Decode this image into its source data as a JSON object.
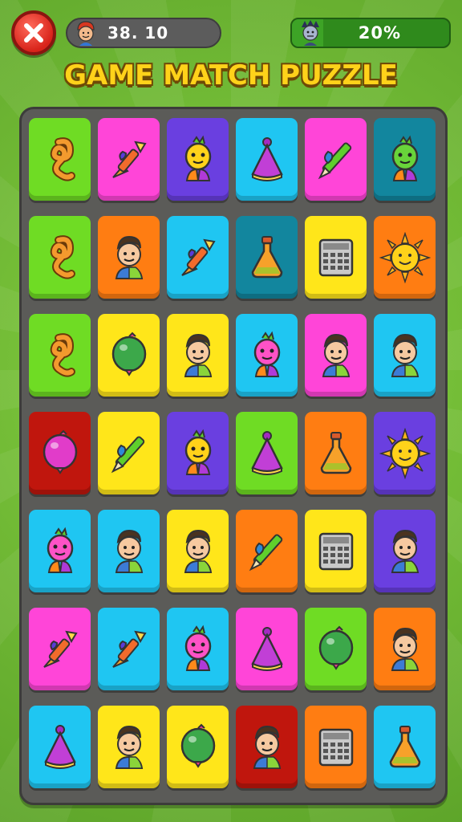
{
  "hud": {
    "score": "38. 10",
    "progress_text": "20%",
    "progress_value": 0.2
  },
  "title": "GAME MATCH PUZZLE",
  "colors": {
    "lime": "#6fdc24",
    "pink": "#ff45d8",
    "purple": "#6a3fe0",
    "cyan": "#1fc6f2",
    "teal": "#12869e",
    "orange": "#ff7d12",
    "yellow": "#ffe61a",
    "red": "#c0160d"
  },
  "board": {
    "rows": [
      [
        {
          "color": "lime",
          "icon": "swirl"
        },
        {
          "color": "pink",
          "icon": "brush"
        },
        {
          "color": "purple",
          "icon": "creature"
        },
        {
          "color": "cyan",
          "icon": "party-hat"
        },
        {
          "color": "pink",
          "icon": "pen"
        },
        {
          "color": "teal",
          "icon": "creature"
        }
      ],
      [
        {
          "color": "lime",
          "icon": "swirl"
        },
        {
          "color": "orange",
          "icon": "person"
        },
        {
          "color": "cyan",
          "icon": "brush"
        },
        {
          "color": "teal",
          "icon": "flask"
        },
        {
          "color": "yellow",
          "icon": "calculator"
        },
        {
          "color": "orange",
          "icon": "sun"
        }
      ],
      [
        {
          "color": "lime",
          "icon": "swirl"
        },
        {
          "color": "yellow",
          "icon": "balloon"
        },
        {
          "color": "yellow",
          "icon": "person"
        },
        {
          "color": "cyan",
          "icon": "creature"
        },
        {
          "color": "pink",
          "icon": "person"
        },
        {
          "color": "cyan",
          "icon": "person"
        }
      ],
      [
        {
          "color": "red",
          "icon": "balloon"
        },
        {
          "color": "yellow",
          "icon": "pen"
        },
        {
          "color": "purple",
          "icon": "creature"
        },
        {
          "color": "lime",
          "icon": "party-hat"
        },
        {
          "color": "orange",
          "icon": "flask"
        },
        {
          "color": "purple",
          "icon": "sun"
        }
      ],
      [
        {
          "color": "cyan",
          "icon": "creature"
        },
        {
          "color": "cyan",
          "icon": "person"
        },
        {
          "color": "yellow",
          "icon": "person"
        },
        {
          "color": "orange",
          "icon": "pen"
        },
        {
          "color": "yellow",
          "icon": "calculator"
        },
        {
          "color": "purple",
          "icon": "person"
        }
      ],
      [
        {
          "color": "pink",
          "icon": "brush"
        },
        {
          "color": "cyan",
          "icon": "brush"
        },
        {
          "color": "cyan",
          "icon": "creature"
        },
        {
          "color": "pink",
          "icon": "party-hat"
        },
        {
          "color": "lime",
          "icon": "balloon"
        },
        {
          "color": "orange",
          "icon": "person"
        }
      ],
      [
        {
          "color": "cyan",
          "icon": "party-hat"
        },
        {
          "color": "yellow",
          "icon": "person"
        },
        {
          "color": "yellow",
          "icon": "balloon"
        },
        {
          "color": "red",
          "icon": "person"
        },
        {
          "color": "orange",
          "icon": "calculator"
        },
        {
          "color": "cyan",
          "icon": "flask"
        }
      ]
    ]
  }
}
